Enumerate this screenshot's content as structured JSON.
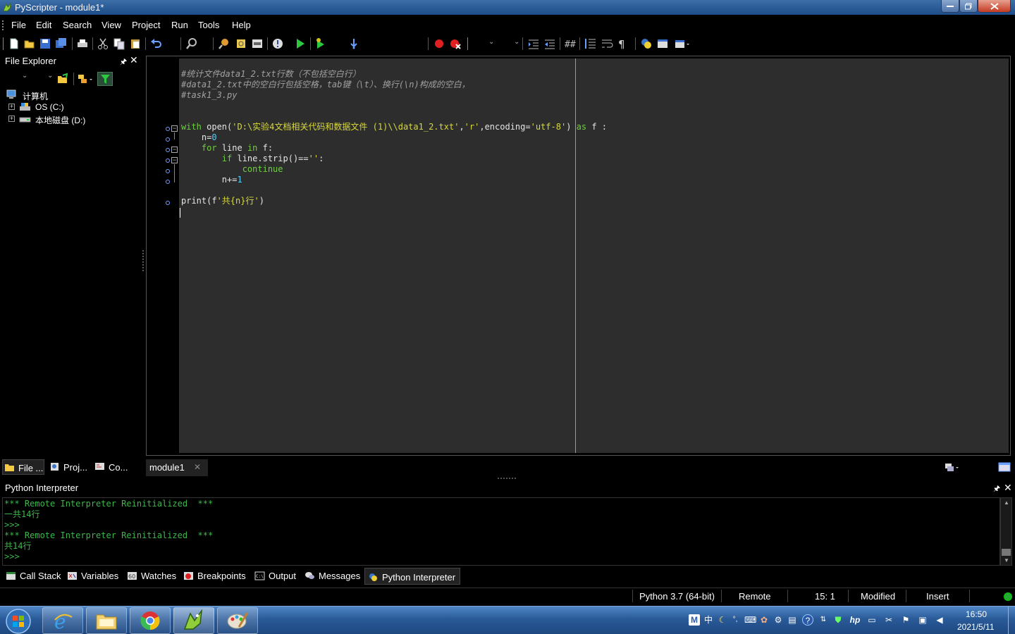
{
  "window": {
    "title": "PyScripter - module1*"
  },
  "menu": [
    "File",
    "Edit",
    "Search",
    "View",
    "Project",
    "Run",
    "Tools",
    "Help"
  ],
  "file_explorer": {
    "title": "File Explorer",
    "tree": [
      {
        "label": "计算机",
        "icon": "computer-icon"
      },
      {
        "label": "OS (C:)",
        "icon": "drive-icon"
      },
      {
        "label": "本地磁盘 (D:)",
        "icon": "drive-icon"
      }
    ],
    "tabs": [
      "File ...",
      "Proj...",
      "Co..."
    ]
  },
  "editor": {
    "lines": [
      "#统计文件data1_2.txt行数（不包括空白行）",
      "#data1_2.txt中的空白行包括空格，tab键（\\t）、换行(\\n)构成的空白，",
      "#task1_3.py",
      "",
      "",
      "with open('D:\\实验4文档相关代码和数据文件 (1)\\\\data1_2.txt','r',encoding='utf-8') as f :",
      "    n=0",
      "    for line in f:",
      "        if line.strip()=='':",
      "            continue",
      "        n+=1",
      "",
      "print(f'共{n}行')"
    ],
    "tab_label": "module1",
    "tab_close": "✕"
  },
  "interpreter": {
    "title": "Python Interpreter",
    "output": [
      "*** Remote Interpreter Reinitialized  ***",
      "一共14行",
      ">>>",
      "*** Remote Interpreter Reinitialized  ***",
      "共14行",
      ">>>"
    ]
  },
  "bottom_tabs": [
    "Call Stack",
    "Variables",
    "Watches",
    "Breakpoints",
    "Output",
    "Messages",
    "Python Interpreter"
  ],
  "status": {
    "python_version": "Python 3.7 (64-bit)",
    "engine": "Remote",
    "position": "15:  1",
    "modified": "Modified",
    "mode": "Insert"
  },
  "taskbar": {
    "time": "16:50",
    "date": "2021/5/11",
    "ime": "中"
  },
  "colors": {
    "comment": "#a0a0a0",
    "keyword": "#6fcf3f",
    "string": "#d8d83c",
    "number": "#55ccff",
    "interpreter_text": "#3cb84a",
    "editor_bg": "#2d2d2d"
  }
}
